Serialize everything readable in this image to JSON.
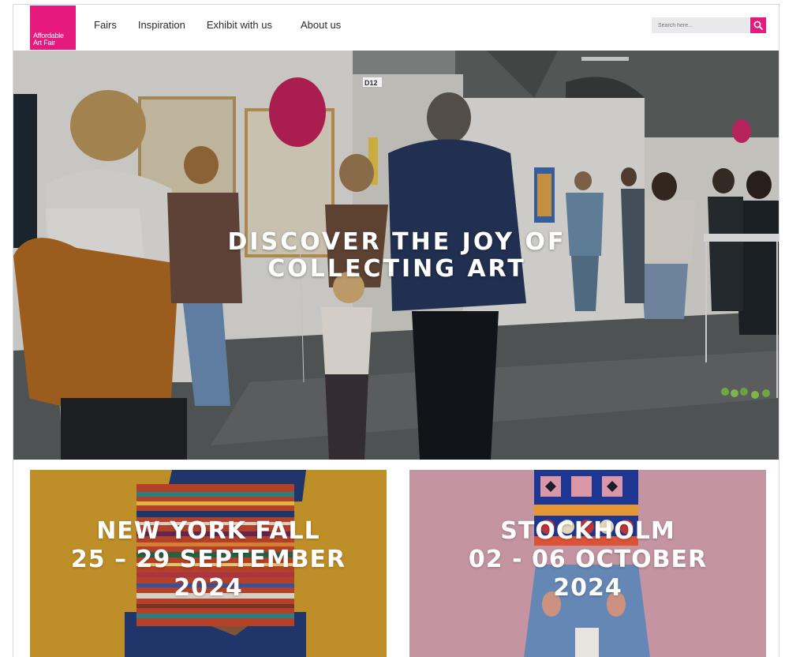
{
  "header": {
    "logo_line1": "Affordable",
    "logo_line2": "Art Fair",
    "nav": [
      {
        "label": "Fairs"
      },
      {
        "label": "Inspiration"
      },
      {
        "label": "Exhibit with us"
      },
      {
        "label": "About us"
      }
    ],
    "search": {
      "placeholder": "Search here..."
    }
  },
  "hero": {
    "title_line1": "DISCOVER THE JOY OF",
    "title_line2": "COLLECTING ART",
    "booth_sign": "D12"
  },
  "fairs": [
    {
      "city": "NEW YORK FALL",
      "dates": "25 – 29 SEPTEMBER",
      "year": "2024"
    },
    {
      "city": "STOCKHOLM",
      "dates": "02 - 06 OCTOBER",
      "year": "2024"
    }
  ],
  "colors": {
    "brand_pink": "#e6197e",
    "ny_card_bg": "#cf9b2c",
    "stockholm_card_bg": "#cf9eaa"
  },
  "icons": {
    "search_button": "search-icon"
  }
}
